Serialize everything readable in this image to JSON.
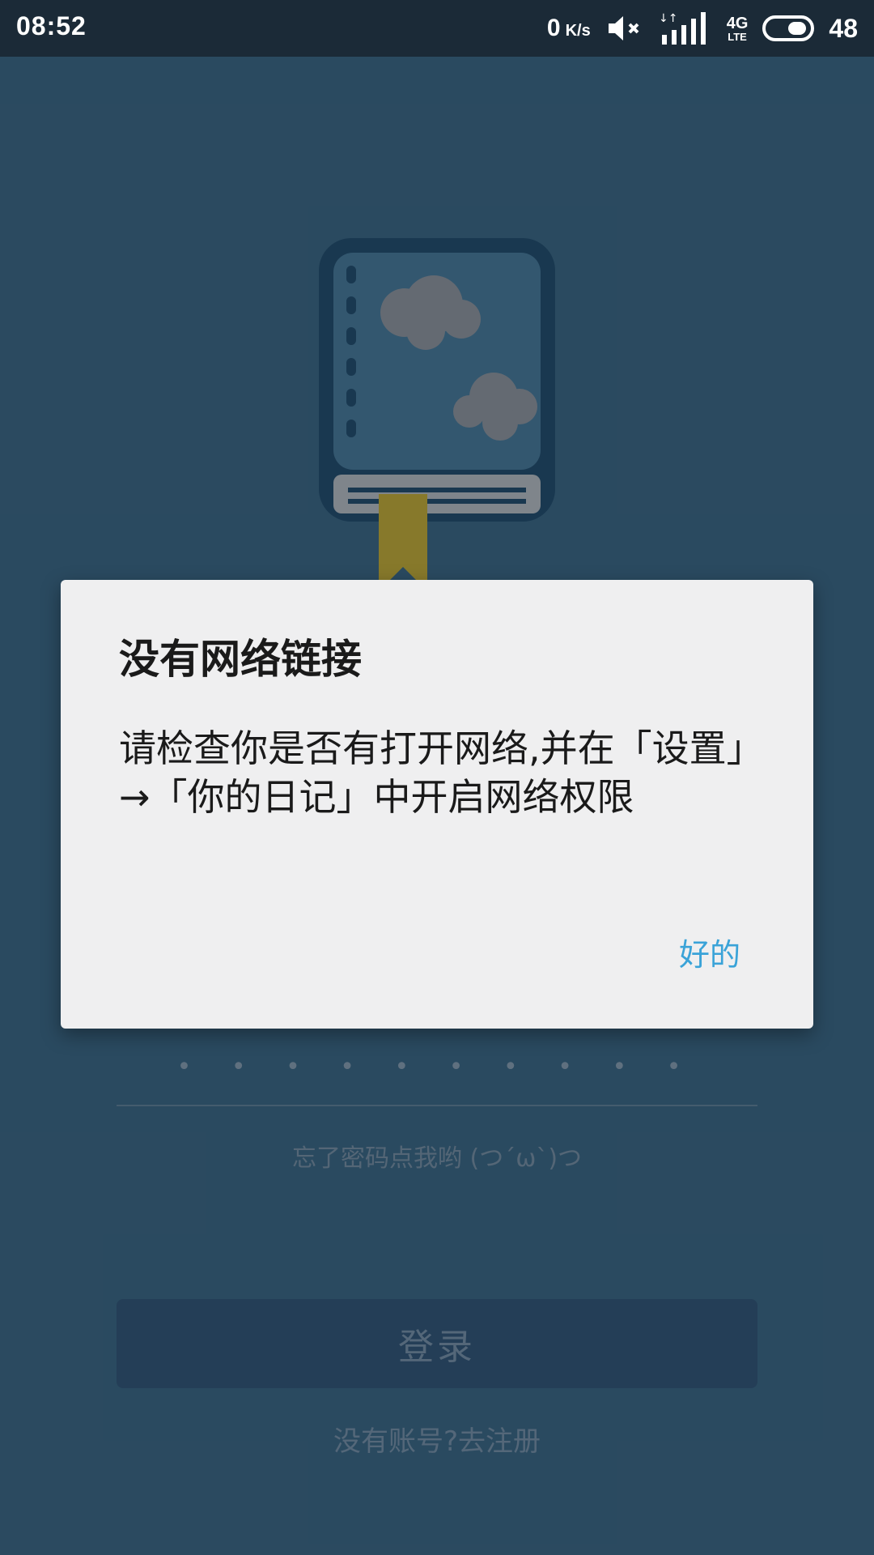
{
  "status_bar": {
    "time": "08:52",
    "net_speed_value": "0",
    "net_speed_unit": "K/s",
    "network_type": "4G",
    "network_sub": "LTE",
    "battery": "48",
    "icons": [
      "mute-icon",
      "data-arrows-icon",
      "signal-icon",
      "4g-lte-icon",
      "battery-icon"
    ]
  },
  "login": {
    "password_dots": "• • • • • • • • • •",
    "forgot_password": "忘了密码点我哟 (つ´ω`)つ",
    "login_button": "登录",
    "register_link": "没有账号?去注册"
  },
  "dialog": {
    "title": "没有网络链接",
    "message": "请检查你是否有打开网络,并在「设置」→「你的日记」中开启网络权限",
    "ok_button": "好的"
  },
  "colors": {
    "status_bar_bg": "#1b2a37",
    "app_bg": "#3f6e8a",
    "dialog_bg": "#efeff0",
    "accent": "#3aa3d8",
    "logo_ribbon": "#e8c42a"
  }
}
